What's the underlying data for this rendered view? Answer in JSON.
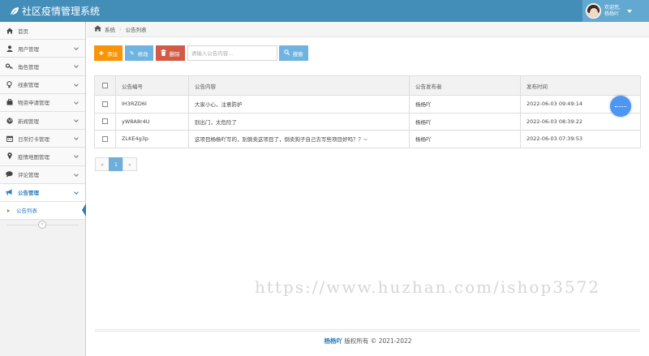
{
  "header": {
    "app_title": "社区疫情管理系统",
    "user_greeting": "欢迎您,",
    "user_name": "杨杨吖"
  },
  "sidebar": {
    "items": [
      {
        "label": "首页",
        "icon": "home-icon"
      },
      {
        "label": "用户管理",
        "icon": "user-icon"
      },
      {
        "label": "角色管理",
        "icon": "key-icon"
      },
      {
        "label": "线索管理",
        "icon": "lightbulb-icon"
      },
      {
        "label": "物资申请管理",
        "icon": "briefcase-icon"
      },
      {
        "label": "新闻管理",
        "icon": "globe-icon"
      },
      {
        "label": "日常打卡管理",
        "icon": "calendar-icon"
      },
      {
        "label": "疫情地图管理",
        "icon": "map-marker-icon"
      },
      {
        "label": "评论管理",
        "icon": "comment-icon"
      },
      {
        "label": "公告管理",
        "icon": "bullhorn-icon"
      }
    ],
    "sub_item": "公告列表"
  },
  "breadcrumb": {
    "root": "系统",
    "current": "公告列表"
  },
  "toolbar": {
    "add_label": "添加",
    "edit_label": "修改",
    "delete_label": "删除",
    "search_placeholder": "请输入公告内容...",
    "search_label": "搜索"
  },
  "table": {
    "columns": [
      "公告编号",
      "公告内容",
      "公告发布者",
      "发布时间"
    ],
    "rows": [
      {
        "id": "IH3RZD6l",
        "content": "大家小心，注意防护",
        "publisher": "杨杨吖",
        "time": "2022-06-03 09:49:14"
      },
      {
        "id": "yW8A8r4U",
        "content": "别出门，太危险了",
        "publisher": "杨杨吖",
        "time": "2022-06-03 08:39:22"
      },
      {
        "id": "ZLKE4g3p",
        "content": "这项目杨杨吖写的，别倒卖这项目了，倒卖狗子自己去写些项目好吗？？~",
        "publisher": "杨杨吖",
        "time": "2022-06-03 07:39:53"
      }
    ]
  },
  "pager": {
    "prev": "«",
    "page": "1",
    "next": "»"
  },
  "watermark": "https://www.huzhan.com/ishop3572",
  "footer": {
    "owner": "杨杨吖",
    "copyright": "版权所有 © 2021-2022"
  },
  "colors": {
    "header_bg": "#438eb9",
    "accent": "#2b7dbc",
    "add_button": "#f89406",
    "edit_button": "#6fb3e0",
    "delete_button": "#d15b47"
  }
}
